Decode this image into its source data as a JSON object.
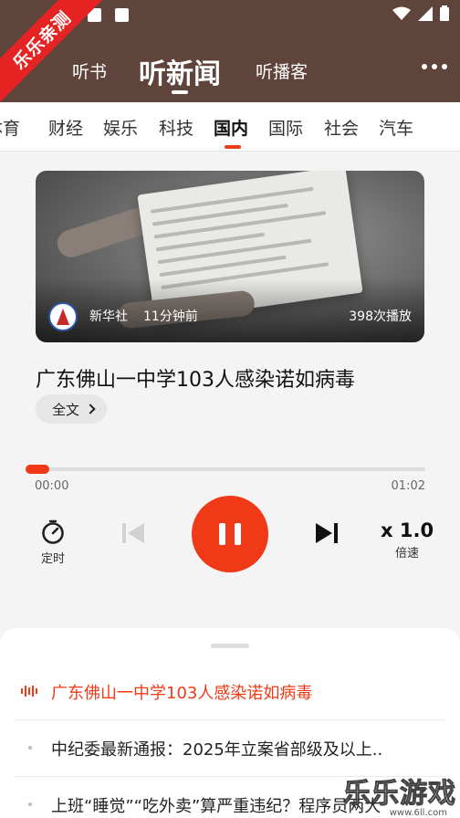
{
  "watermark": {
    "ribbon_text": "乐乐亲测",
    "site_text": "乐乐游戏",
    "site_url": "www.6ll.com"
  },
  "header": {
    "tabs": [
      {
        "label": "听书"
      },
      {
        "label": "听新闻"
      },
      {
        "label": "听播客"
      }
    ],
    "active_tab_index": 1
  },
  "categories": {
    "items": [
      "体育",
      "财经",
      "娱乐",
      "科技",
      "国内",
      "国际",
      "社会",
      "汽车"
    ],
    "active": "国内"
  },
  "article": {
    "source": "新华社",
    "time_ago": "11分钟前",
    "plays": "398次播放",
    "title": "广东佛山一中学103人感染诺如病毒",
    "fulltext_label": "全文"
  },
  "player": {
    "current_time": "00:00",
    "total_time": "01:02",
    "progress": 0.03,
    "timer_label": "定时",
    "speed_value": "x 1.0",
    "speed_label": "倍速"
  },
  "playlist": [
    {
      "title": "广东佛山一中学103人感染诺如病毒",
      "active": true
    },
    {
      "title": "中纪委最新通报：2025年立案省部级及以上..",
      "active": false
    },
    {
      "title": "上班“睡觉”“吃外卖”算严重违纪？程序员两大",
      "active": false
    }
  ],
  "colors": {
    "header_bg": "#5e443a",
    "accent": "#f03a17",
    "ribbon": "#e52323"
  },
  "icons": [
    "back-icon",
    "more-icon",
    "timer-icon",
    "previous-icon",
    "pause-icon",
    "next-icon",
    "playing-equalizer-icon"
  ]
}
